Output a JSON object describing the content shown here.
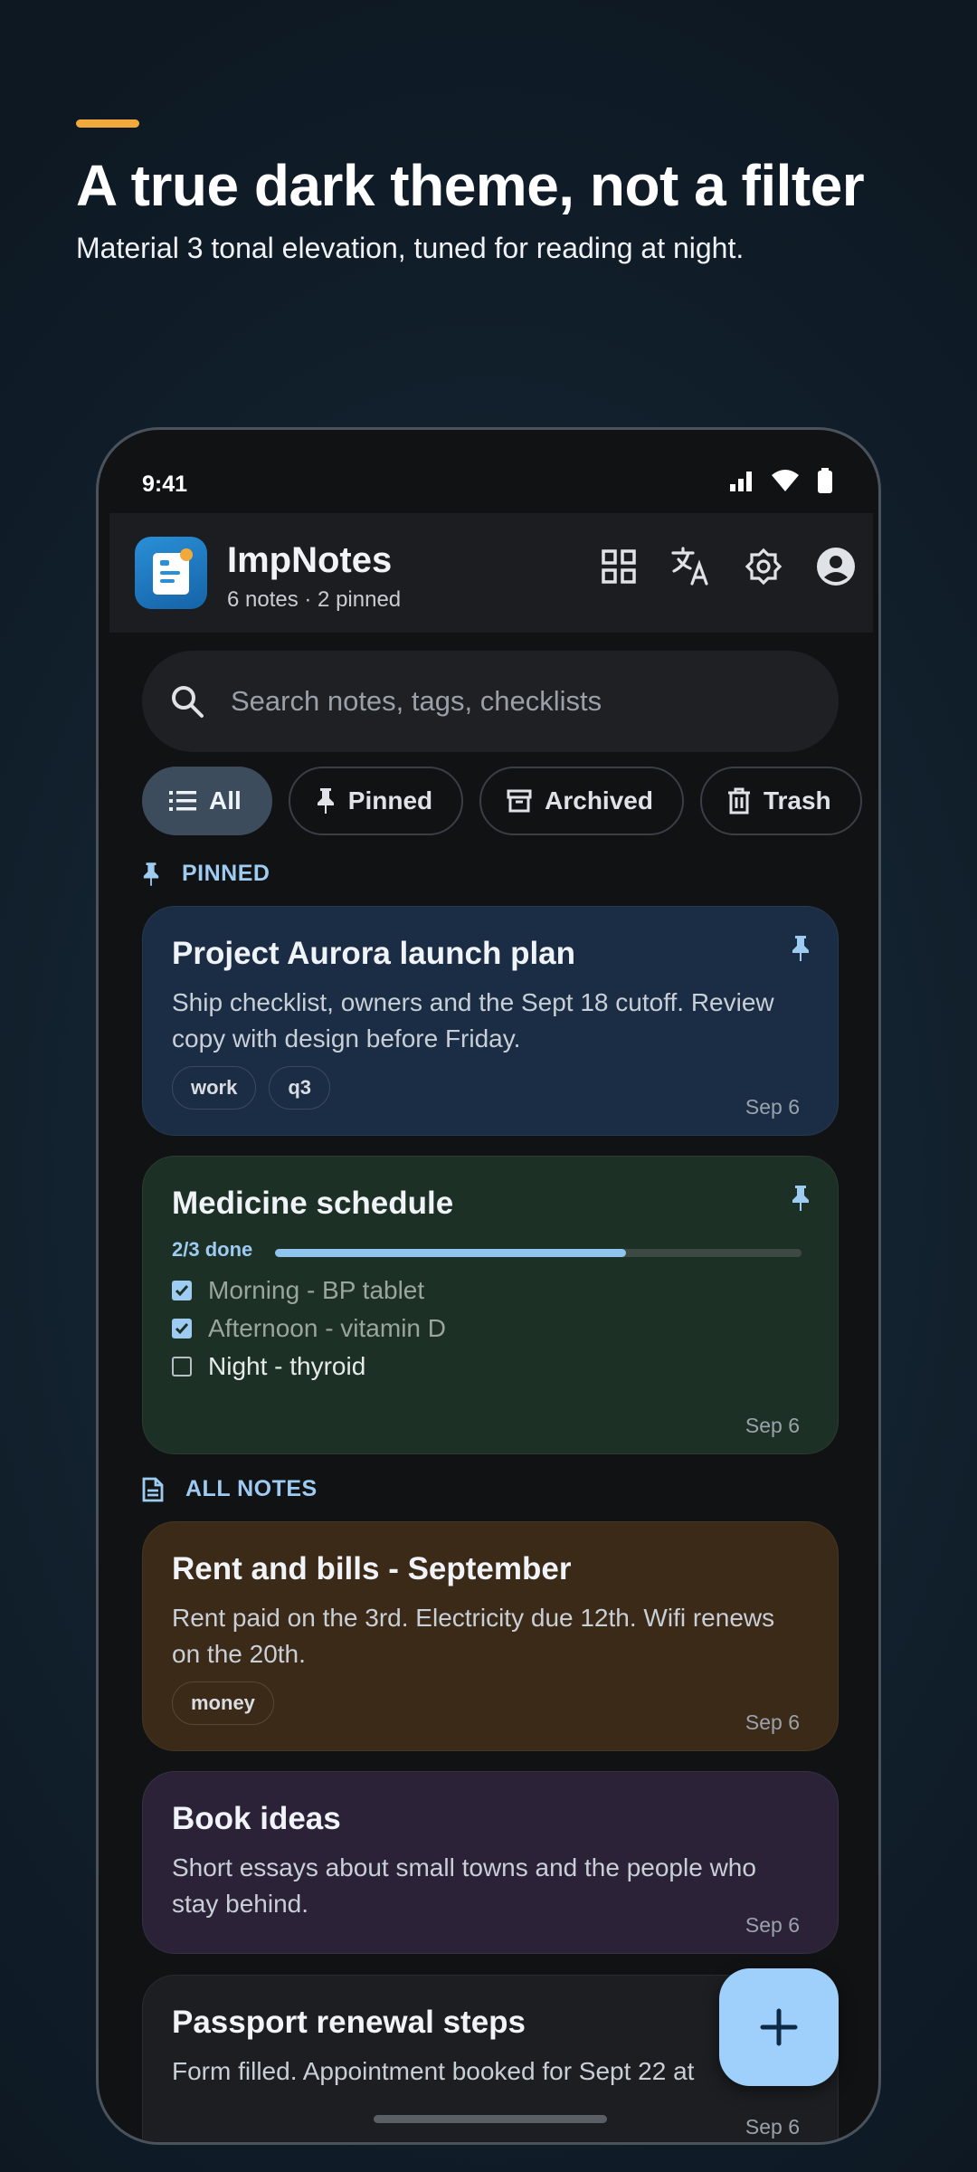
{
  "promo": {
    "accent_color": "#f2a93b",
    "headline": "A true dark theme, not a filter",
    "subline": "Material 3 tonal elevation, tuned for reading at night."
  },
  "status_bar": {
    "time": "9:41",
    "icons": [
      "signal-icon",
      "wifi-icon",
      "battery-icon"
    ]
  },
  "app_bar": {
    "title": "ImpNotes",
    "subtitle": "6 notes · 2 pinned",
    "actions": [
      "grid-view-icon",
      "translate-icon",
      "brightness-icon",
      "account-icon"
    ]
  },
  "search": {
    "placeholder": "Search notes, tags, checklists"
  },
  "filters": [
    {
      "label": "All",
      "icon": "list-icon",
      "active": true
    },
    {
      "label": "Pinned",
      "icon": "pin-icon",
      "active": false
    },
    {
      "label": "Archived",
      "icon": "archive-icon",
      "active": false
    },
    {
      "label": "Trash",
      "icon": "trash-icon",
      "active": false
    }
  ],
  "sections": {
    "pinned": "PINNED",
    "all": "ALL NOTES"
  },
  "notes": [
    {
      "title": "Project Aurora launch plan",
      "body": "Ship checklist, owners and the Sept 18 cutoff. Review copy with design before Friday.",
      "tags": [
        "work",
        "q3"
      ],
      "date": "Sep 6",
      "pinned": true,
      "color": "#1b2d45"
    },
    {
      "title": "Medicine schedule",
      "progress_label": "2/3 done",
      "progress": 0.667,
      "checklist": [
        {
          "text": "Morning - BP tablet",
          "done": true
        },
        {
          "text": "Afternoon - vitamin D",
          "done": true
        },
        {
          "text": "Night - thyroid",
          "done": false
        }
      ],
      "date": "Sep 6",
      "pinned": true,
      "color": "#1c3025"
    },
    {
      "title": "Rent and bills - September",
      "body": "Rent paid on the 3rd. Electricity due 12th. Wifi renews on the 20th.",
      "tags": [
        "money"
      ],
      "date": "Sep 6",
      "pinned": false,
      "color": "#3b2a17"
    },
    {
      "title": "Book ideas",
      "body": "Short essays about small towns and the people who stay behind.",
      "date": "Sep 6",
      "pinned": false,
      "color": "#2b2238"
    },
    {
      "title": "Passport renewal steps",
      "body": "Form filled. Appointment booked for Sept 22 at",
      "date": "Sep 6",
      "pinned": false,
      "color": "#1c1e21"
    }
  ],
  "fab": {
    "icon": "plus-icon"
  }
}
